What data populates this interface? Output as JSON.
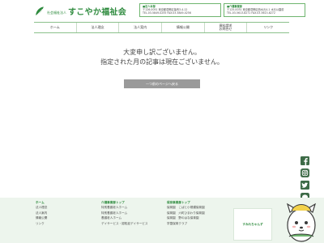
{
  "header": {
    "org_type": "社会福祉法人",
    "org_name": "すこやか福祉会",
    "offices": [
      {
        "name": "■法人本部",
        "line1": "〒126-0051 東京都葛飾区亀有3-4-12",
        "line2": "TEL.03-5849-0255 FAX.03-5849-0256"
      },
      {
        "name": "■介護事業部",
        "line1": "〒125-0031 東京都葛飾区西水元4-1 水元公園前",
        "line2": "TEL.03-5613-8271 FAX.03-5613-8272"
      }
    ]
  },
  "nav": {
    "items": [
      {
        "label": "ホーム"
      },
      {
        "label": "法人理念"
      },
      {
        "label": "法人案内"
      },
      {
        "label": "情報公開"
      },
      {
        "label": "資料請求\nお問合せ"
      },
      {
        "label": "リンク"
      }
    ]
  },
  "main": {
    "message_line1": "大変申し訳ございません。",
    "message_line2": "指定された月の記事は現在ございません。",
    "back_button": "一つ前のページへ戻る"
  },
  "social": {
    "icons": [
      "facebook-icon",
      "instagram-icon",
      "twitter-icon",
      "line-icon",
      "youtube-icon"
    ]
  },
  "footer": {
    "col1": {
      "heading": "ホーム",
      "items": [
        "法人理念",
        "法人案内",
        "情報公開",
        "リンク"
      ]
    },
    "col2": {
      "heading": "介護事業部トップ",
      "items": [
        "特別養護老人ホーム",
        "特別養護老人ホーム",
        "養護老人ホーム",
        "デイサービス・認知症デイサービス"
      ]
    },
    "col3": {
      "heading": "保育事業部トップ",
      "items": [
        "保育園　こばと小規模保育園",
        "保育園　六町ひまわり保育園",
        "保育園　野のはな保育園",
        "学童保育クラブ"
      ]
    },
    "banner": "すみれちゃんず"
  },
  "colors": {
    "brand_green": "#2e8b3e",
    "footer_bg": "#edf5ed",
    "button_gray": "#9a9a9a"
  }
}
